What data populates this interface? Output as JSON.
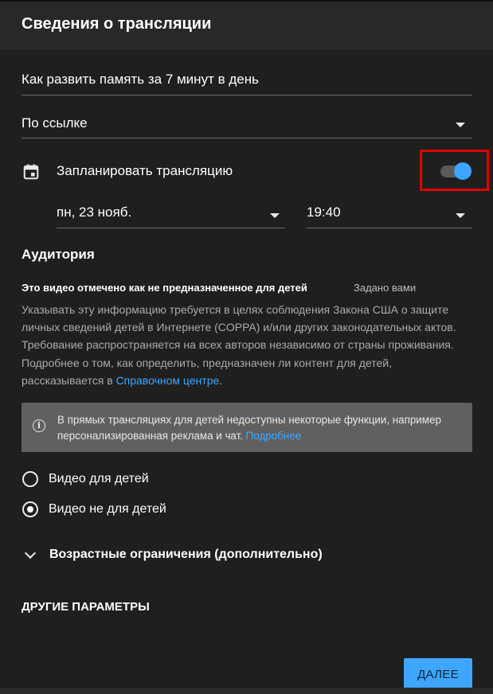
{
  "dialog": {
    "title": "Сведения о трансляции"
  },
  "form": {
    "stream_title": "Как развить память за 7 минут в день",
    "visibility": "По ссылке",
    "schedule": {
      "label": "Запланировать трансляцию",
      "enabled": true,
      "date": "пн, 23 нояб.",
      "time": "19:40"
    }
  },
  "audience": {
    "title": "Аудитория",
    "status": "Это видео отмечено как не предназначенное для детей",
    "set_by": "Задано вами",
    "description": "Указывать эту информацию требуется в целях соблюдения Закона США о защите личных сведений детей в Интернете (COPPA) и/или других законодательных актов. Требование распространяется на всех авторов независимо от страны проживания. Подробнее о том, как определить, предназначен ли контент для детей, рассказывается в ",
    "help_link": "Справочном центре",
    "description_end": ".",
    "info_text": "В прямых трансляциях для детей недоступны некоторые функции, например персонализированная реклама и чат. ",
    "info_link": "Подробнее",
    "options": [
      {
        "label": "Видео для детей",
        "selected": false
      },
      {
        "label": "Видео не для детей",
        "selected": true
      }
    ],
    "age_restrictions": "Возрастные ограничения (дополнительно)"
  },
  "other": {
    "title": "ДРУГИЕ ПАРАМЕТРЫ"
  },
  "footer": {
    "next_label": "ДАЛЕЕ"
  },
  "colors": {
    "accent": "#3ea6ff",
    "highlight": "#e00000",
    "background": "#1f1f1f"
  },
  "icons": {
    "calendar": "calendar-icon",
    "info": "info-icon",
    "dropdown": "arrow-drop-down-icon",
    "expand": "chevron-down-icon"
  }
}
